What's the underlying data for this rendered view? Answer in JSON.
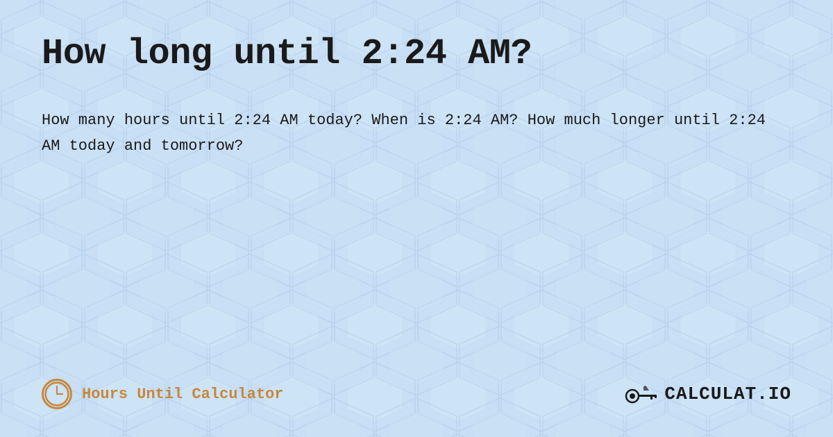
{
  "page": {
    "title": "How long until 2:24 AM?",
    "description": "How many hours until 2:24 AM today? When is 2:24 AM? How much longer until 2:24 AM today and tomorrow?",
    "footer": {
      "brand_label": "Hours Until Calculator",
      "logo_text": "CALCULAT.IO"
    },
    "background_color": "#c8dff5",
    "accent_color": "#c8873a"
  }
}
